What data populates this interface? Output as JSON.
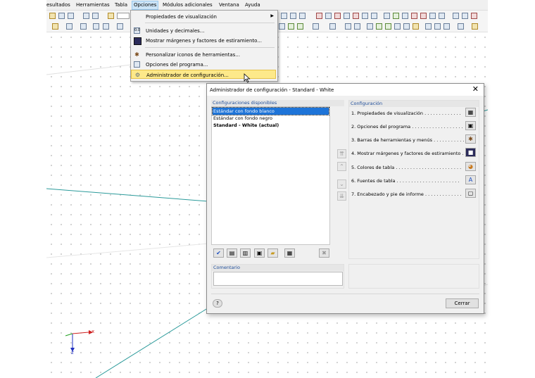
{
  "menubar": {
    "items": [
      "esultados",
      "Herramientas",
      "Tabla",
      "Opciones",
      "Módulos adicionales",
      "Ventana",
      "Ayuda"
    ],
    "active": "Opciones"
  },
  "options_menu": {
    "items": [
      {
        "label": "Propiedades de visualización",
        "icon": "display-properties-icon",
        "submenu": true
      },
      {
        "label": "Unidades y decimales...",
        "icon": "units-icon"
      },
      {
        "label": "Mostrar márgenes y factores de estiramiento...",
        "icon": "margins-icon"
      },
      {
        "label": "Personalizar iconos de herramientas...",
        "icon": "customize-toolbar-icon"
      },
      {
        "label": "Opciones del programa...",
        "icon": "program-options-icon"
      },
      {
        "label": "Administrador de configuración...",
        "icon": "config-manager-icon",
        "highlighted": true
      }
    ]
  },
  "dialog": {
    "title": "Administrador de configuración - Standard - White",
    "close_glyph": "✕",
    "available": {
      "header": "Configuraciones disponibles",
      "items": [
        {
          "label": "Estándar con fondo blanco",
          "selected": true
        },
        {
          "label": "Estándar con fondo negro"
        },
        {
          "label": "Standard - White (actual)",
          "bold": true
        }
      ]
    },
    "configuration": {
      "header": "Configuración",
      "items": [
        "1. Propiedades de visualización . . . . . . . . . . . . .",
        "2. Opciones del programa . . . . . . . . . . . . . . . . . .",
        "3. Barras de herramientas y menús . . . . . . . . . . .",
        "4. Mostrar márgenes y factores de estiramiento . .",
        "5. Colores de tabla . . . . . . . . . . . . . . . . . . . . . . .",
        "6. Fuentes de tabla . . . . . . . . . . . . . . . . . . . . . .",
        "7. Encabezado y pie de informe . . . . . . . . . . . . ."
      ]
    },
    "comment": {
      "header": "Comentario",
      "value": ""
    },
    "close_button": "Cerrar",
    "help_glyph": "?"
  },
  "axes": {
    "x": "x",
    "z": "z"
  },
  "colors": {
    "accent": "#1e74d8",
    "menu_highlight": "#fde98a",
    "grid_line": "#2a9a9a",
    "header_text": "#1f4e9a"
  }
}
